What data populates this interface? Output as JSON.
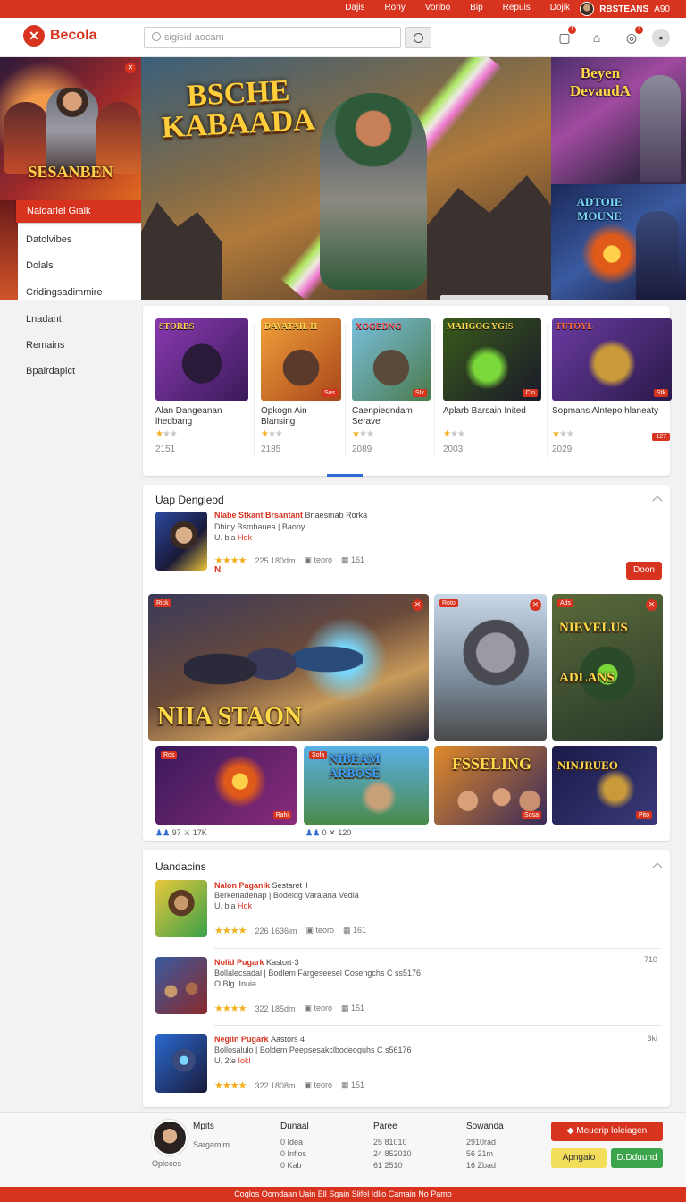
{
  "topbar": {
    "links": [
      "Dajis",
      "Rony",
      "Vonbo",
      "Bip",
      "Repuis",
      "Dojik"
    ],
    "user_name": "RBSTEANS",
    "user_extra": "A90"
  },
  "header": {
    "logo_text": "Becola",
    "search_placeholder": "sigisid aocam",
    "icons": [
      "bell-icon",
      "box-icon",
      "message-icon",
      "avatar-icon"
    ],
    "badges": [
      "1",
      "3"
    ]
  },
  "left_promo": {
    "title": "SESANBEN"
  },
  "left_menu": {
    "active": "Naldarlel Gialk",
    "items": [
      "Datolvibes",
      "Dolals",
      "Cridingsadimmire",
      "Lnadant",
      "Remains",
      "Bpairdaplct"
    ]
  },
  "hero": {
    "title_line1": "BSCHE",
    "title_line2": "KABAADA"
  },
  "right_promos": [
    {
      "title": "Beyen DevaudA"
    },
    {
      "title": "ADTOIE MOUNE"
    }
  ],
  "carousel": {
    "cards": [
      {
        "label": "STORBS",
        "tag": "",
        "name": "Alan Dangeanan lhedbang",
        "stars_on": 1,
        "price": "2151"
      },
      {
        "label": "DAVATAIL H",
        "tag": "Sos",
        "name": "Opkogn Ain Blansing",
        "stars_on": 1,
        "price": "2185"
      },
      {
        "label": "XOGEDNG",
        "tag": "Stk",
        "name": "Caenpiedndam Serave",
        "stars_on": 1,
        "price": "2089"
      },
      {
        "label": "MAHGOG YGIS",
        "tag": "Cln",
        "name": "Aplarb Barsain Inited",
        "stars_on": 1,
        "price": "2003"
      },
      {
        "label": "TUTOYL",
        "tag": "Stk",
        "name": "Sopmans Alntepo hlaneaty",
        "stars_on": 1,
        "price": "2029",
        "side_tag": "127"
      }
    ]
  },
  "panel2": {
    "title": "Uap Dengleod",
    "featured": {
      "title": "Nlabe Stkant Brsantant",
      "title_rest": "Bnaesmab Rorka",
      "line2": "Dbiny Bsmbauea | Baony",
      "line3": "U. bia",
      "line3_red": "Hok",
      "rating_text": "225 180dm",
      "meta2": "teoro",
      "meta3": "161",
      "mark": "N",
      "button": "Doon"
    },
    "tiles_row1": [
      {
        "title": "NIIA STAON",
        "tl": "Rick"
      },
      {
        "title": "",
        "tl": "Roto"
      },
      {
        "title": "NIEVELUS ADLANS",
        "tl": "Ads"
      }
    ],
    "tiles_row2": [
      {
        "title": "",
        "tl": "Ros",
        "br": "Rahi"
      },
      {
        "title": "NIBEAM ARBOSE",
        "tl": "Sofa"
      },
      {
        "title": "FSSELING",
        "tl": "",
        "br": "Sosa"
      },
      {
        "title": "NINJRUEO",
        "tl": "",
        "br": "Pito"
      }
    ],
    "stats": [
      {
        "a": "97",
        "b": "17K"
      },
      {
        "a": "0",
        "b": "120"
      }
    ]
  },
  "panel3": {
    "title": "Uandacins",
    "rows": [
      {
        "title": "Nalon Paganik",
        "title_rest": "Sestaret ll",
        "line2": "Berkenadenap | Bodeldg Varalana Vedia",
        "line3": "U. bia",
        "line3_red": "Hok",
        "rating": "226 1636im",
        "meta2": "teoro",
        "meta3": "161",
        "side": ""
      },
      {
        "title": "Nolid Pugark",
        "title_rest": "Kastort·3",
        "line2": "Bollalecsadal | Bodlem Fargeseesel Cosengchs  C ss5176",
        "line3": "O Blg. Inuia",
        "line3_red": "",
        "rating": "322 185dm",
        "meta2": "teoro",
        "meta3": "151",
        "side": "710"
      },
      {
        "title": "Neglin Pugark",
        "title_rest": "Aastors 4",
        "line2": "Bollosalulo | Boldem Peepsesakclbodeoguhs  C s56176",
        "line3": "U. 2te",
        "line3_red": "Iokl",
        "rating": "322 1808m",
        "meta2": "teoro",
        "meta3": "151",
        "side": "3kl"
      }
    ]
  },
  "footer": {
    "profile_label": "Mpits",
    "profile_sub": "Sargamim",
    "profile_foot": "Opleces",
    "cols": [
      {
        "head": "Dunaal",
        "lines": [
          "0 Idea",
          "0 Infios",
          "0 Kab"
        ]
      },
      {
        "head": "Paree",
        "lines": [
          "25 81010",
          "24 852010",
          "61 2510"
        ]
      },
      {
        "head": "Sowanda",
        "lines": [
          "2910rad",
          "56 21m",
          "16 Zbad"
        ]
      }
    ],
    "btn_primary": "Meuerip loleiagen",
    "btn_yellow": "Apngaio",
    "btn_green": "D.Dduund"
  },
  "bottombar": {
    "text": "Coglos Oomdaan Uain   Ell Sgain Slifel Idlio   Camain No Pamo"
  },
  "colors": {
    "brand_red": "#d8331f",
    "accent_blue": "#2f6bd1",
    "green": "#3aa54a",
    "yellow": "#f2de5a"
  }
}
